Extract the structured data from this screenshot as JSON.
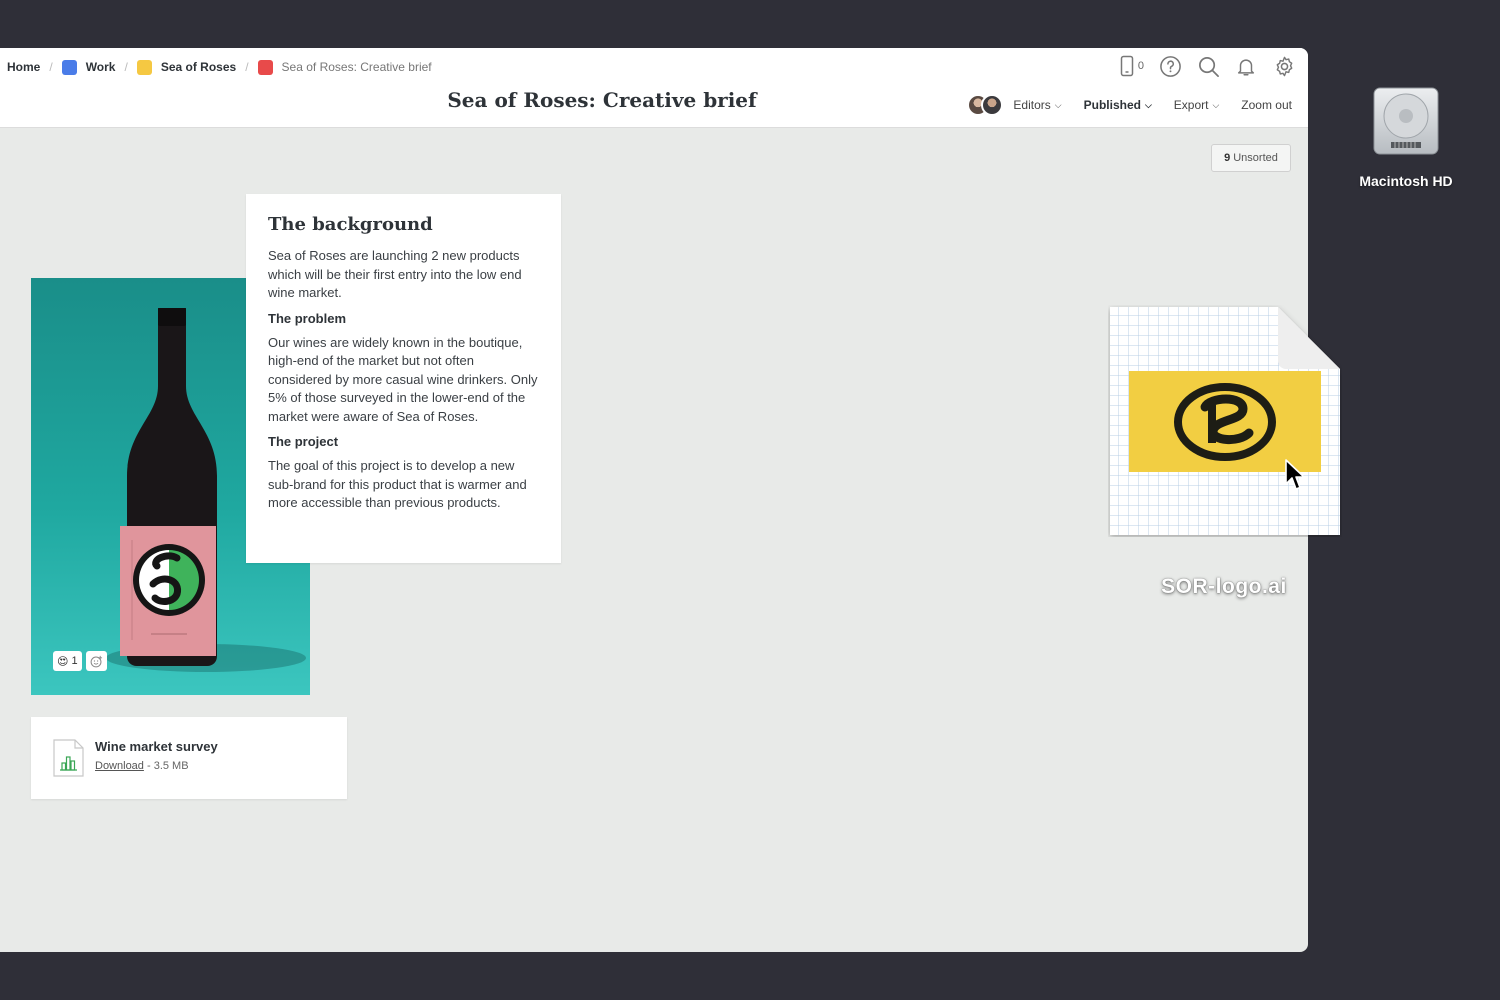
{
  "breadcrumb": {
    "home": "Home",
    "items": [
      {
        "label": "Work",
        "color": "#4a7ce8"
      },
      {
        "label": "Sea of Roses",
        "color": "#f5c842"
      },
      {
        "label": "Sea of Roses: Creative brief",
        "color": "#e84a4a"
      }
    ]
  },
  "header": {
    "title": "Sea of Roses: Creative brief",
    "device_count": "0",
    "icons": [
      "phone-icon",
      "help-icon",
      "search-icon",
      "bell-icon",
      "gear-icon"
    ]
  },
  "toolbar": {
    "editors_label": "Editors",
    "published_label": "Published",
    "export_label": "Export",
    "zoom_label": "Zoom out"
  },
  "unsorted": {
    "count": "9",
    "label": "Unsorted"
  },
  "image_card": {
    "reaction_emoji": "😍",
    "reaction_count": "1"
  },
  "note": {
    "heading": "The background",
    "paragraph1": "Sea of Roses are launching 2 new products which will be their first entry into the low end wine market.",
    "problem_heading": "The problem",
    "paragraph2": "Our wines are widely known in the boutique, high-end of the market but not often considered by more casual wine drinkers. Only 5% of those surveyed in the lower-end of the market were aware of Sea of Roses.",
    "project_heading": "The project",
    "paragraph3": "The goal of this project is to develop a new sub-brand for this product that is warmer and more accessible than previous products."
  },
  "file": {
    "name": "Wine market survey",
    "link": "Download",
    "size": "- 3.5 MB"
  },
  "desktop": {
    "drive_label": "Macintosh HD",
    "dragged_file": "SOR-logo.ai"
  }
}
